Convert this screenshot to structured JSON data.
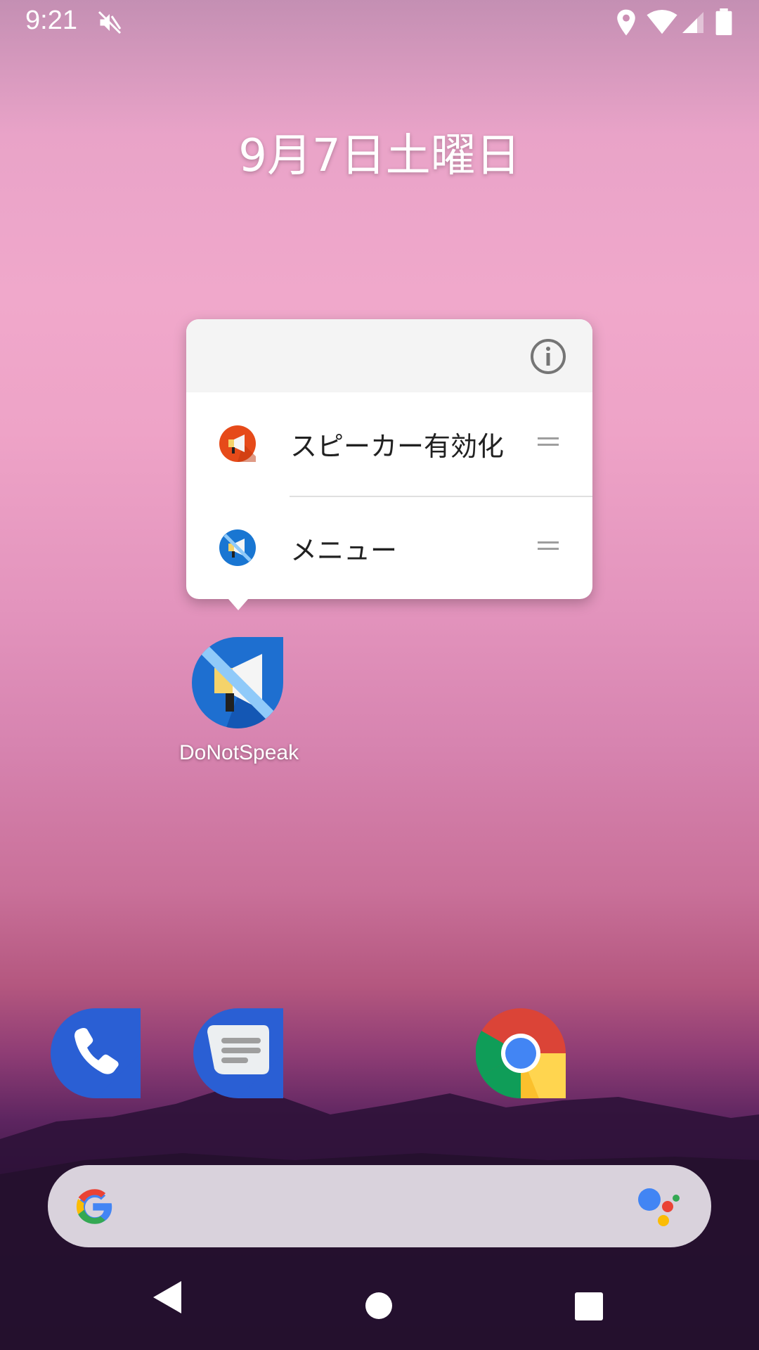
{
  "status_bar": {
    "time": "9:21",
    "icons": [
      "mute-icon",
      "location-icon",
      "wifi-icon",
      "signal-icon",
      "battery-icon"
    ]
  },
  "home": {
    "date": "9月7日土曜日"
  },
  "popup": {
    "info_icon": "info-icon",
    "shortcuts": [
      {
        "label": "スピーカー有効化",
        "icon": "speaker-on-icon",
        "icon_color": "#e64a19"
      },
      {
        "label": "メニュー",
        "icon": "speaker-off-icon",
        "icon_color": "#1976d2"
      }
    ]
  },
  "app": {
    "label": "DoNotSpeak",
    "icon": "donotspeak-app-icon",
    "color": "#1e6fd0"
  },
  "dock": {
    "apps": [
      "phone-app-icon",
      "messages-app-icon",
      "chrome-app-icon"
    ]
  },
  "search": {
    "logo": "google-logo-icon",
    "assistant": "assistant-icon"
  },
  "nav": {
    "buttons": [
      "back-button",
      "home-button",
      "recents-button"
    ]
  }
}
